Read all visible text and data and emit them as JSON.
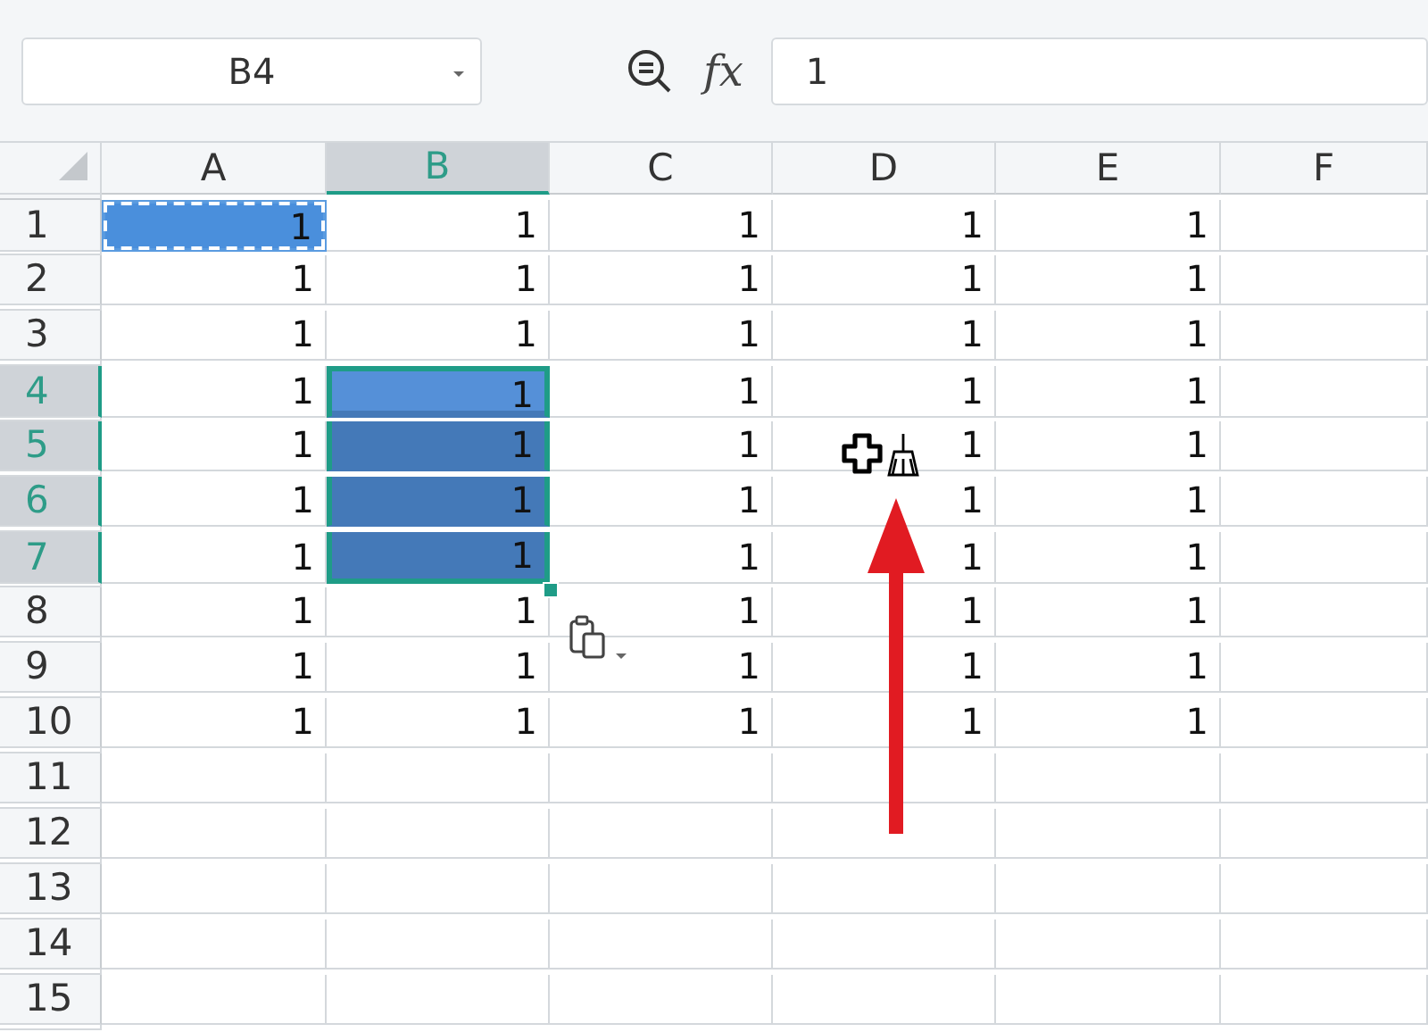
{
  "name_box": {
    "value": "B4"
  },
  "formula_bar": {
    "fx_label": "fx",
    "value": "1"
  },
  "columns": [
    {
      "label": "A",
      "selected": false
    },
    {
      "label": "B",
      "selected": true
    },
    {
      "label": "C",
      "selected": false
    },
    {
      "label": "D",
      "selected": false
    },
    {
      "label": "E",
      "selected": false
    },
    {
      "label": "F",
      "selected": false
    }
  ],
  "rows": [
    {
      "header": "1",
      "selected": false,
      "cells": [
        {
          "value": "1",
          "selected": false,
          "copied": true
        },
        {
          "value": "1",
          "selected": false,
          "copied": false
        },
        {
          "value": "1",
          "selected": false,
          "copied": false
        },
        {
          "value": "1",
          "selected": false,
          "copied": false
        },
        {
          "value": "1",
          "selected": false,
          "copied": false
        }
      ]
    },
    {
      "header": "2",
      "selected": false,
      "cells": [
        {
          "value": "1",
          "selected": false,
          "copied": false
        },
        {
          "value": "1",
          "selected": false,
          "copied": false
        },
        {
          "value": "1",
          "selected": false,
          "copied": false
        },
        {
          "value": "1",
          "selected": false,
          "copied": false
        },
        {
          "value": "1",
          "selected": false,
          "copied": false
        }
      ]
    },
    {
      "header": "3",
      "selected": false,
      "cells": [
        {
          "value": "1",
          "selected": false,
          "copied": false
        },
        {
          "value": "1",
          "selected": false,
          "copied": false
        },
        {
          "value": "1",
          "selected": false,
          "copied": false
        },
        {
          "value": "1",
          "selected": false,
          "copied": false
        },
        {
          "value": "1",
          "selected": false,
          "copied": false
        }
      ]
    },
    {
      "header": "4",
      "selected": true,
      "cells": [
        {
          "value": "1",
          "selected": false,
          "copied": false
        },
        {
          "value": "1",
          "selected": true,
          "copied": false
        },
        {
          "value": "1",
          "selected": false,
          "copied": false
        },
        {
          "value": "1",
          "selected": false,
          "copied": false
        },
        {
          "value": "1",
          "selected": false,
          "copied": false
        }
      ]
    },
    {
      "header": "5",
      "selected": true,
      "cells": [
        {
          "value": "1",
          "selected": false,
          "copied": false
        },
        {
          "value": "1",
          "selected": true,
          "copied": false
        },
        {
          "value": "1",
          "selected": false,
          "copied": false
        },
        {
          "value": "1",
          "selected": false,
          "copied": false
        },
        {
          "value": "1",
          "selected": false,
          "copied": false
        }
      ]
    },
    {
      "header": "6",
      "selected": true,
      "cells": [
        {
          "value": "1",
          "selected": false,
          "copied": false
        },
        {
          "value": "1",
          "selected": true,
          "copied": false
        },
        {
          "value": "1",
          "selected": false,
          "copied": false
        },
        {
          "value": "1",
          "selected": false,
          "copied": false
        },
        {
          "value": "1",
          "selected": false,
          "copied": false
        }
      ]
    },
    {
      "header": "7",
      "selected": true,
      "cells": [
        {
          "value": "1",
          "selected": false,
          "copied": false
        },
        {
          "value": "1",
          "selected": true,
          "copied": false
        },
        {
          "value": "1",
          "selected": false,
          "copied": false
        },
        {
          "value": "1",
          "selected": false,
          "copied": false
        },
        {
          "value": "1",
          "selected": false,
          "copied": false
        }
      ]
    },
    {
      "header": "8",
      "selected": false,
      "cells": [
        {
          "value": "1",
          "selected": false,
          "copied": false
        },
        {
          "value": "1",
          "selected": false,
          "copied": false
        },
        {
          "value": "1",
          "selected": false,
          "copied": false
        },
        {
          "value": "1",
          "selected": false,
          "copied": false
        },
        {
          "value": "1",
          "selected": false,
          "copied": false
        }
      ]
    },
    {
      "header": "9",
      "selected": false,
      "cells": [
        {
          "value": "1",
          "selected": false,
          "copied": false
        },
        {
          "value": "1",
          "selected": false,
          "copied": false
        },
        {
          "value": "1",
          "selected": false,
          "copied": false
        },
        {
          "value": "1",
          "selected": false,
          "copied": false
        },
        {
          "value": "1",
          "selected": false,
          "copied": false
        }
      ]
    },
    {
      "header": "10",
      "selected": false,
      "cells": [
        {
          "value": "1",
          "selected": false,
          "copied": false
        },
        {
          "value": "1",
          "selected": false,
          "copied": false
        },
        {
          "value": "1",
          "selected": false,
          "copied": false
        },
        {
          "value": "1",
          "selected": false,
          "copied": false
        },
        {
          "value": "1",
          "selected": false,
          "copied": false
        }
      ]
    },
    {
      "header": "11",
      "selected": false
    },
    {
      "header": "12",
      "selected": false
    },
    {
      "header": "13",
      "selected": false
    },
    {
      "header": "14",
      "selected": false
    },
    {
      "header": "15",
      "selected": false
    }
  ]
}
